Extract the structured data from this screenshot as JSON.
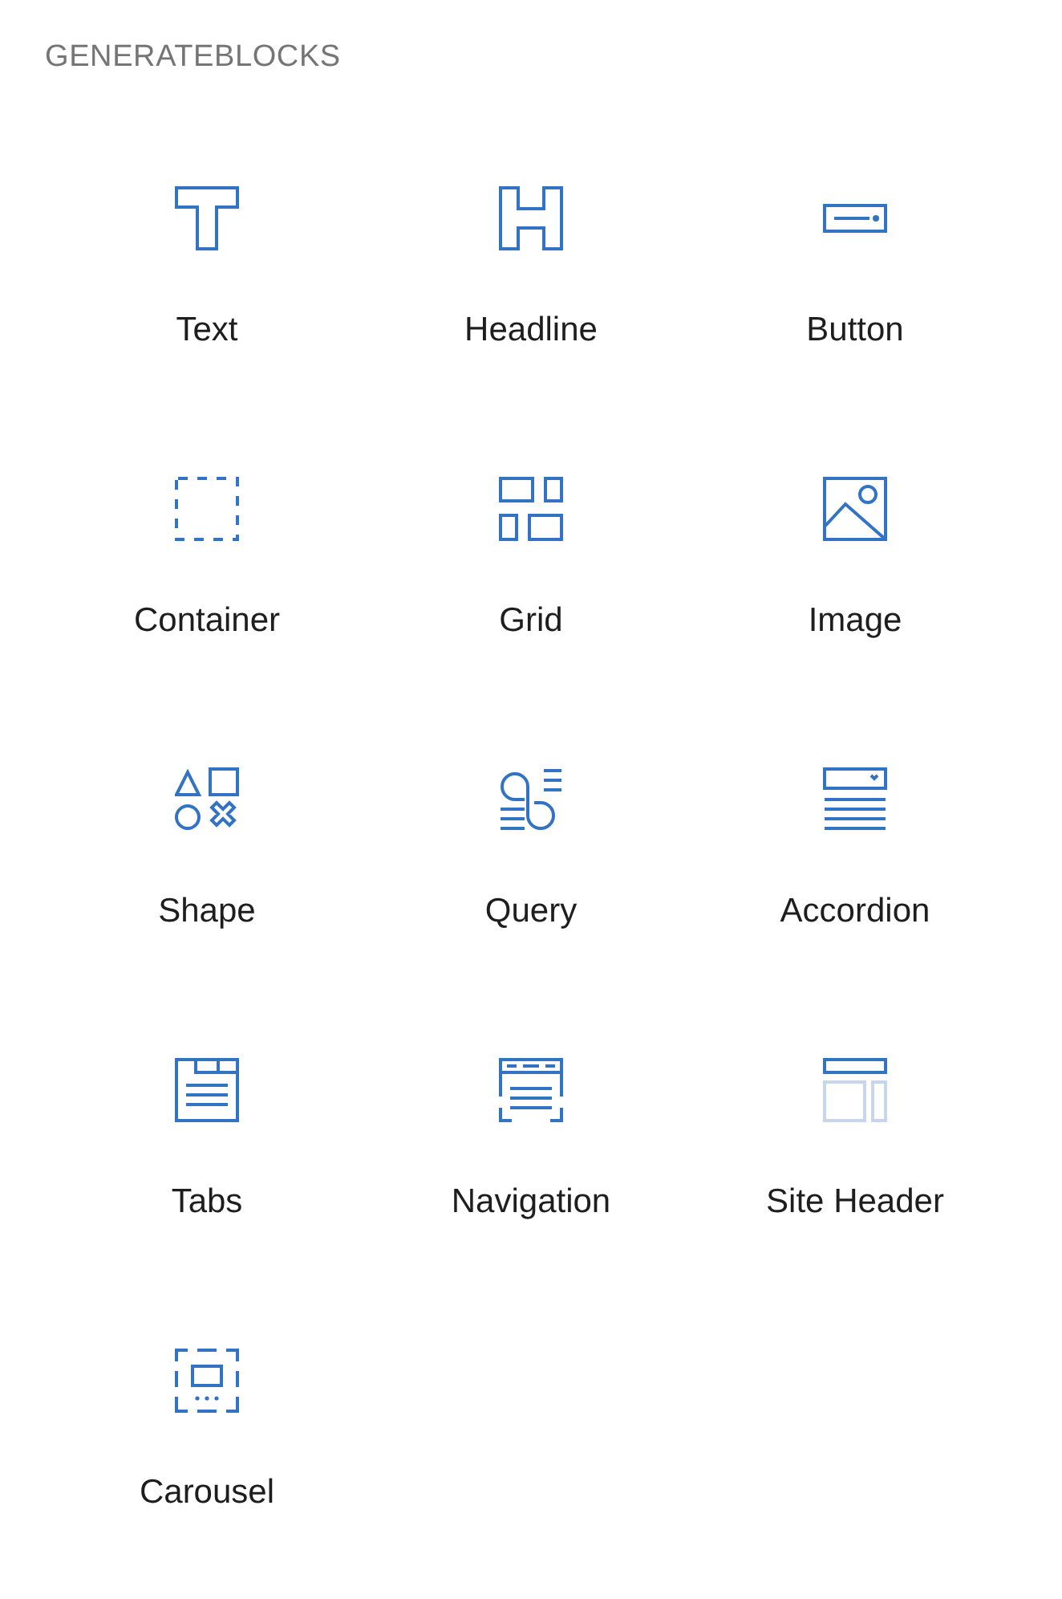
{
  "section": {
    "title": "GENERATEBLOCKS"
  },
  "blocks": [
    {
      "kind": "text",
      "label": "Text"
    },
    {
      "kind": "headline",
      "label": "Headline"
    },
    {
      "kind": "button",
      "label": "Button"
    },
    {
      "kind": "container",
      "label": "Container"
    },
    {
      "kind": "grid",
      "label": "Grid"
    },
    {
      "kind": "image",
      "label": "Image"
    },
    {
      "kind": "shape",
      "label": "Shape"
    },
    {
      "kind": "query",
      "label": "Query"
    },
    {
      "kind": "accordion",
      "label": "Accordion"
    },
    {
      "kind": "tabs",
      "label": "Tabs"
    },
    {
      "kind": "navigation",
      "label": "Navigation"
    },
    {
      "kind": "site-header",
      "label": "Site Header"
    },
    {
      "kind": "carousel",
      "label": "Carousel"
    }
  ]
}
